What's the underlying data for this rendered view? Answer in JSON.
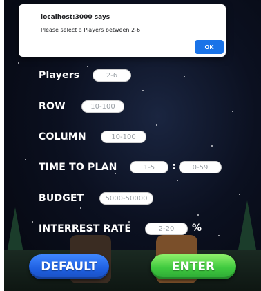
{
  "dialog": {
    "title": "localhost:3000 says",
    "message": "Please select a Players between 2-6",
    "ok_label": "OK"
  },
  "form": {
    "players": {
      "label": "Players",
      "placeholder": "2-6"
    },
    "row": {
      "label": "ROW",
      "placeholder": "10-100"
    },
    "column": {
      "label": "COLUMN",
      "placeholder": "10-100"
    },
    "time_to_plan": {
      "label": "TIME TO PLAN",
      "placeholder_min": "1-5",
      "separator": ":",
      "placeholder_sec": "0-59"
    },
    "budget": {
      "label": "BUDGET",
      "placeholder": "5000-50000"
    },
    "interest_rate": {
      "label": "INTERREST RATE",
      "placeholder": "2-20",
      "suffix": "%"
    }
  },
  "buttons": {
    "default_label": "DEFAULT",
    "enter_label": "ENTER"
  },
  "colors": {
    "default_button": "#1e5fe0",
    "enter_button": "#3fc93f",
    "ok_button": "#1a73e8"
  }
}
